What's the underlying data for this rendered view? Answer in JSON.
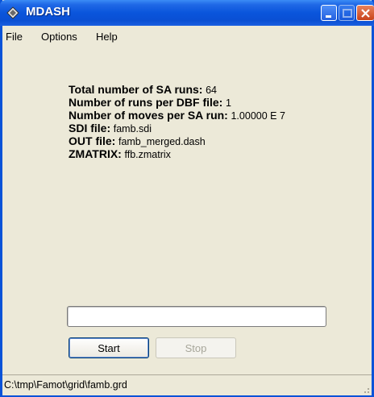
{
  "window": {
    "title": "MDASH",
    "icons": {
      "app": "mdash-diamond-icon",
      "minimize": "minimize-icon",
      "maximize": "maximize-icon",
      "close": "close-icon"
    }
  },
  "menu": [
    "File",
    "Options",
    "Help"
  ],
  "info": [
    {
      "label": "Total number of SA runs:",
      "value": "64"
    },
    {
      "label": "Number of runs per DBF file:",
      "value": "1"
    },
    {
      "label": "Number of moves per SA run:",
      "value": "1.00000 E 7"
    },
    {
      "label": "SDI file:",
      "value": "famb.sdi"
    },
    {
      "label": "OUT file:",
      "value": "famb_merged.dash"
    },
    {
      "label": "ZMATRIX:",
      "value": "ffb.zmatrix"
    }
  ],
  "progress": {
    "value": 0
  },
  "buttons": {
    "start": "Start",
    "stop": "Stop"
  },
  "status": {
    "path": "C:\\tmp\\Famot\\grid\\famb.grd"
  },
  "colors": {
    "titlebar": "#0a55dc",
    "window_bg": "#ece9d8",
    "close": "#c8421a"
  }
}
